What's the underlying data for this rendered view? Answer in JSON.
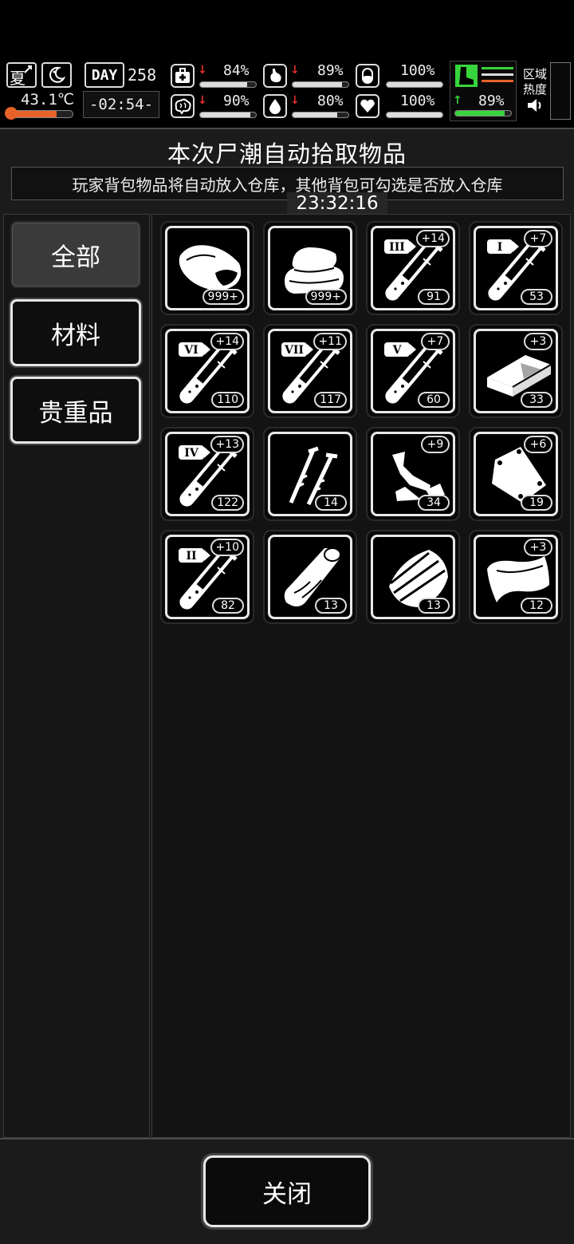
{
  "hud": {
    "season": "夏",
    "temperature": "43.1℃",
    "day_label": "DAY",
    "day_number": "258",
    "clock": "-02:54-",
    "stats": {
      "health": {
        "value": "84%",
        "level": 0.84
      },
      "hunger": {
        "value": "89%",
        "level": 0.89
      },
      "stamina": {
        "value": "100%",
        "level": 1.0
      },
      "sanity": {
        "value": "90%",
        "level": 0.9
      },
      "thirst": {
        "value": "80%",
        "level": 0.8
      },
      "mood": {
        "value": "100%",
        "level": 1.0
      },
      "speed": {
        "value": "89%",
        "level": 0.89
      }
    },
    "region_heat_label": "区域\n热度",
    "colors": {
      "down_arrow": "#e0302a",
      "up_arrow": "#38d43c",
      "temp_bar": "#e8622a",
      "speed_bar": "#38d43c"
    }
  },
  "panel": {
    "title": "本次尸潮自动拾取物品",
    "subtitle": "玩家背包物品将自动放入仓库，其他背包可勾选是否放入仓库",
    "timestamp": "23:32:16"
  },
  "tabs": [
    {
      "label": "全部",
      "active": true
    },
    {
      "label": "材料",
      "active": false
    },
    {
      "label": "贵重品",
      "active": false
    }
  ],
  "items": [
    {
      "icon": "meat-icon",
      "count": "999+",
      "bonus": ""
    },
    {
      "icon": "cloth-icon",
      "count": "999+",
      "bonus": ""
    },
    {
      "icon": "test-tube-iii-icon",
      "roman": "III",
      "count": "91",
      "bonus": "+14"
    },
    {
      "icon": "test-tube-i-icon",
      "roman": "I",
      "count": "53",
      "bonus": "+7"
    },
    {
      "icon": "test-tube-vi-icon",
      "roman": "VI",
      "count": "110",
      "bonus": "+14"
    },
    {
      "icon": "test-tube-vii-icon",
      "roman": "VII",
      "count": "117",
      "bonus": "+11"
    },
    {
      "icon": "test-tube-v-icon",
      "roman": "V",
      "count": "60",
      "bonus": "+7"
    },
    {
      "icon": "ingot-icon",
      "count": "33",
      "bonus": "+3"
    },
    {
      "icon": "test-tube-iv-icon",
      "roman": "IV",
      "count": "122",
      "bonus": "+13"
    },
    {
      "icon": "nails-icon",
      "count": "14",
      "bonus": ""
    },
    {
      "icon": "scrap-metal-icon",
      "count": "34",
      "bonus": "+9"
    },
    {
      "icon": "metal-plate-icon",
      "count": "19",
      "bonus": "+6"
    },
    {
      "icon": "test-tube-ii-icon",
      "roman": "II",
      "count": "82",
      "bonus": "+10"
    },
    {
      "icon": "wood-log-icon",
      "count": "13",
      "bonus": ""
    },
    {
      "icon": "wood-planks-icon",
      "count": "13",
      "bonus": ""
    },
    {
      "icon": "leather-icon",
      "count": "12",
      "bonus": "+3"
    }
  ],
  "footer": {
    "close_label": "关闭"
  }
}
